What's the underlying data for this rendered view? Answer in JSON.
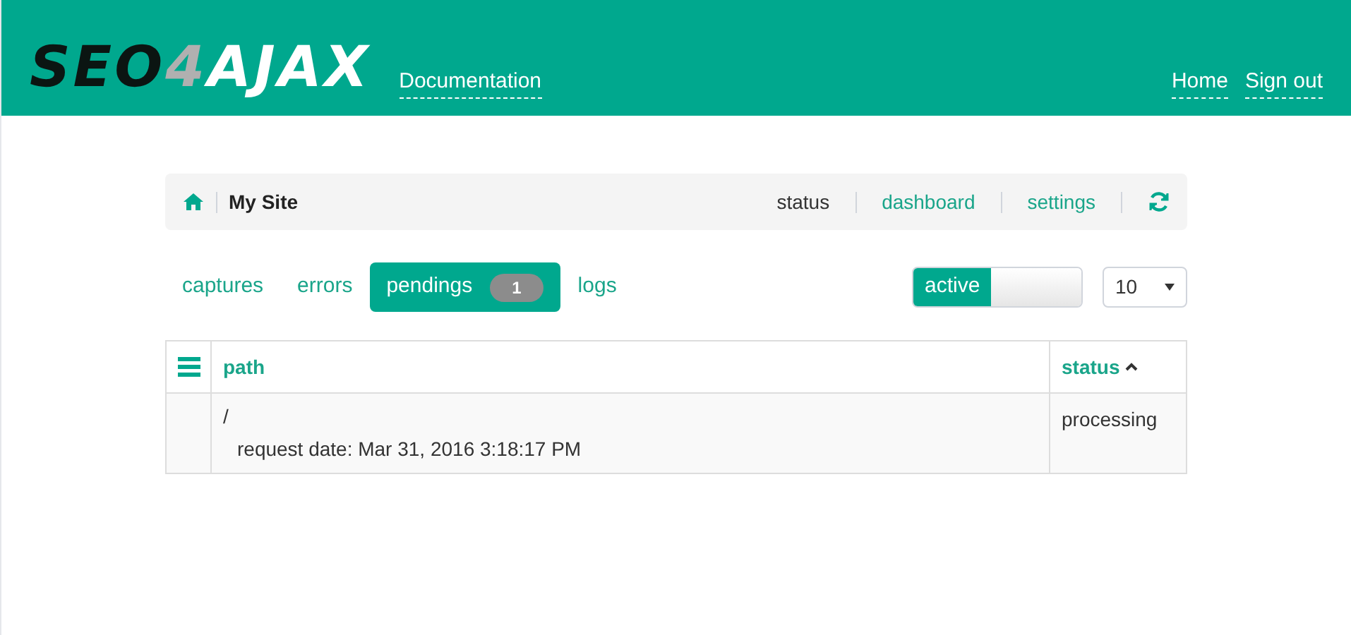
{
  "header": {
    "logo": [
      {
        "text": "SEO",
        "kind": "dark"
      },
      {
        "text": "4",
        "kind": "grey"
      },
      {
        "text": "AJAX",
        "kind": "light"
      }
    ],
    "links": [
      "Documentation"
    ],
    "right_links": [
      "Home",
      "Sign out"
    ]
  },
  "breadcrumb": {
    "site": "My Site",
    "nav": [
      {
        "label": "status",
        "selected": true
      },
      {
        "label": "dashboard",
        "selected": false
      },
      {
        "label": "settings",
        "selected": false
      }
    ]
  },
  "tabs": [
    {
      "label": "captures",
      "selected": false
    },
    {
      "label": "errors",
      "selected": false
    },
    {
      "label": "pendings",
      "selected": true,
      "count": "1"
    },
    {
      "label": "logs",
      "selected": false
    }
  ],
  "toggle": {
    "label": "active",
    "on": true
  },
  "page_size": {
    "value": "10"
  },
  "table": {
    "columns": [
      {
        "label": "path",
        "sorted": false
      },
      {
        "label": "status",
        "sorted": true
      }
    ],
    "rows": [
      {
        "path": "/",
        "detail": "request date: Mar 31, 2016 3:18:17 PM",
        "status": "processing"
      }
    ]
  }
}
